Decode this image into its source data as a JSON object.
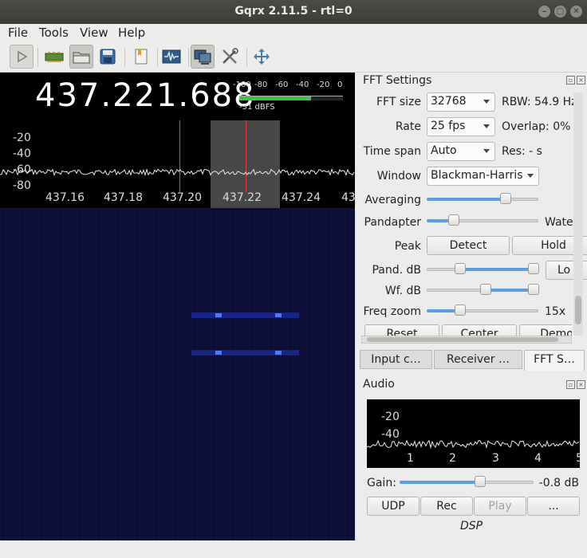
{
  "window": {
    "title": "Gqrx 2.11.5 - rtl=0"
  },
  "menu": {
    "items": [
      "File",
      "Tools",
      "View",
      "Help"
    ]
  },
  "toolbar": {
    "buttons": [
      "play-icon",
      "hardware-icon",
      "open-folder-icon",
      "save-icon",
      "bookmark-icon",
      "waveform-icon",
      "remote-control-icon",
      "tools-icon",
      "fullscreen-icon"
    ]
  },
  "display": {
    "frequency": "437.221.688",
    "meter_scale": [
      "-100",
      "-80",
      "-60",
      "-40",
      "-20",
      "0"
    ],
    "meter_label": "-31 dBFS",
    "meter_level": 0.69,
    "y_ticks": [
      "-20",
      "-40",
      "-60",
      "-80"
    ],
    "x_ticks": [
      "437.16",
      "437.18",
      "437.20",
      "437.22",
      "437.24",
      "43"
    ]
  },
  "fft": {
    "title": "FFT Settings",
    "fft_size_label": "FFT size",
    "fft_size_value": "32768",
    "rbw": "RBW: 54.9 Hz",
    "rate_label": "Rate",
    "rate_value": "25 fps",
    "overlap": "Overlap: 0%",
    "timespan_label": "Time span",
    "timespan_value": "Auto",
    "res": "Res: - s",
    "window_label": "Window",
    "window_value": "Blackman-Harris",
    "averaging_label": "Averaging",
    "averaging_level": 0.71,
    "pandapter_label": "Pandapter",
    "pandapter_level": 0.24,
    "waterfall_label": "Wate",
    "peak_label": "Peak",
    "detect_label": "Detect",
    "hold_label": "Hold",
    "pand_db_label": "Pand. dB",
    "pand_db_range": [
      0.3,
      0.96
    ],
    "lock_label": "Lo",
    "wf_db_label": "Wf. dB",
    "wf_db_range": [
      0.53,
      0.96
    ],
    "freq_zoom_label": "Freq zoom",
    "freq_zoom_level": 0.3,
    "freq_zoom_value": "15x",
    "bottom_buttons": [
      "Reset",
      "Center",
      "Demo"
    ]
  },
  "tabs": [
    "Input c…",
    "Receiver …",
    "FFT S…"
  ],
  "audio": {
    "title": "Audio",
    "y_ticks": [
      "-20",
      "-40"
    ],
    "x_ticks": [
      "1",
      "2",
      "3",
      "4",
      "5"
    ],
    "gain_label": "Gain:",
    "gain_level": 0.6,
    "gain_value": "-0.8 dB",
    "buttons": [
      "UDP",
      "Rec",
      "Play",
      "..."
    ],
    "dsp_label": "DSP"
  },
  "colors": {
    "accent": "#5ba0e0",
    "meter_green": "#3cc43c",
    "titlebar": "#3c3c38"
  }
}
